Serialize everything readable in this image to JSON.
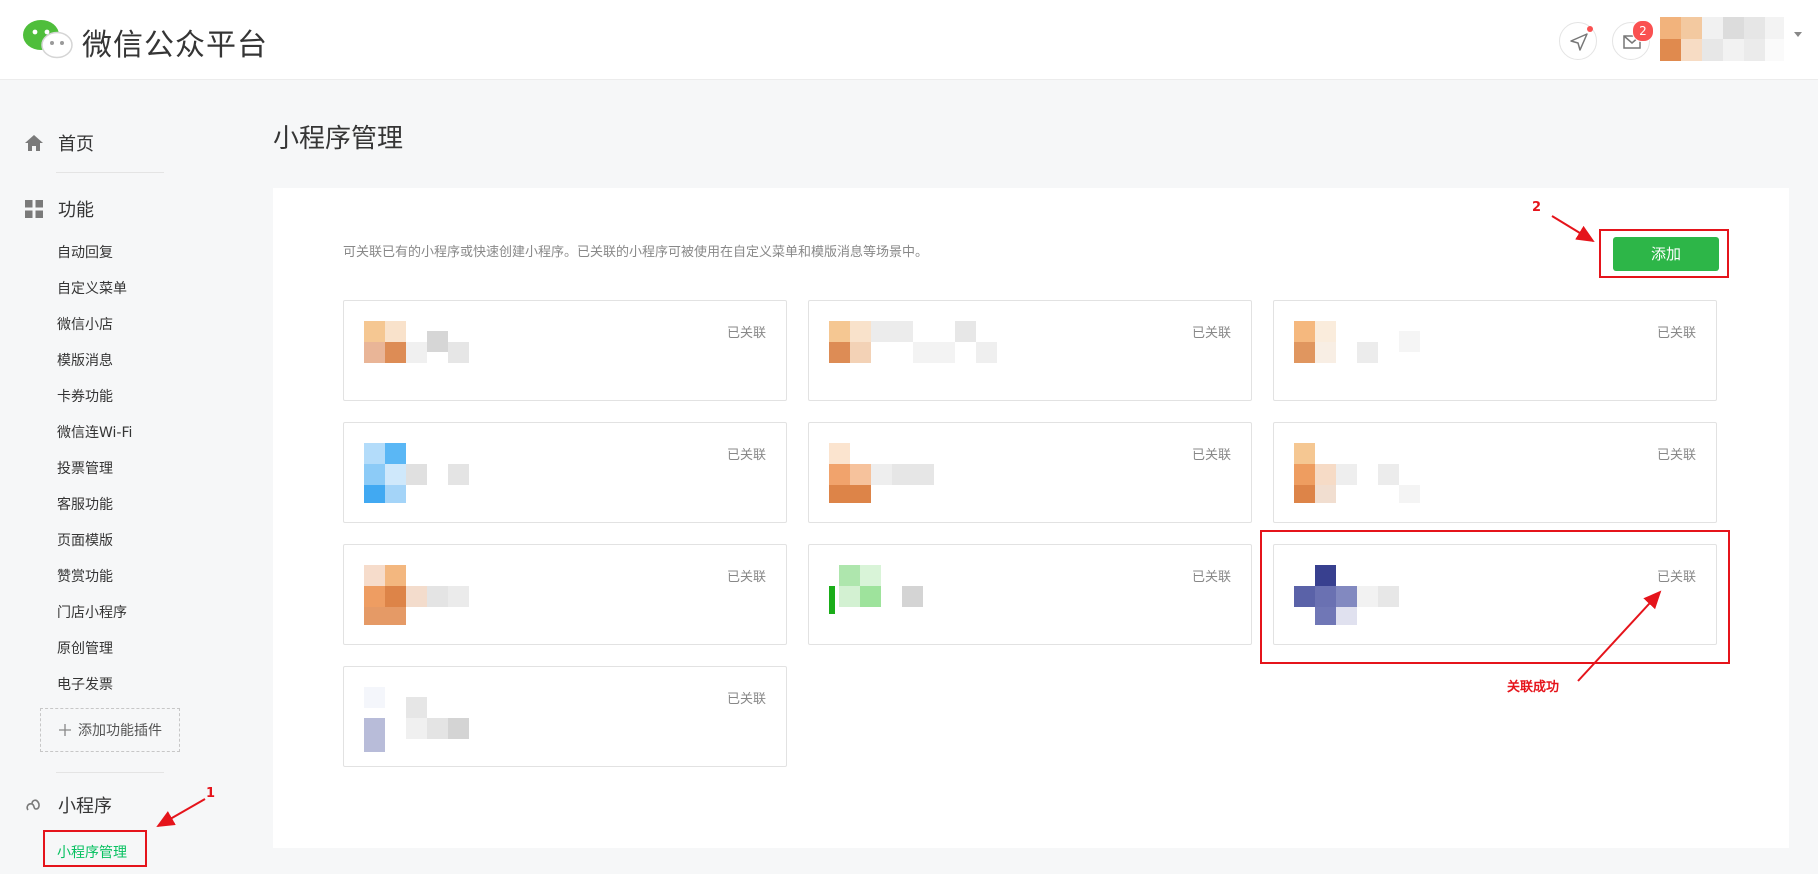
{
  "header": {
    "brand": "微信公众平台",
    "notification_count": "2",
    "icons": [
      "wechat-logo-icon",
      "send-icon",
      "mail-icon"
    ],
    "badge_color": "#fa5151"
  },
  "sidebar": {
    "home": "首页",
    "features": "功能",
    "feature_items": [
      "自动回复",
      "自定义菜单",
      "微信小店",
      "模版消息",
      "卡券功能",
      "微信连Wi-Fi",
      "投票管理",
      "客服功能",
      "页面模版",
      "赞赏功能",
      "门店小程序",
      "原创管理",
      "电子发票"
    ],
    "add_plugin": "添加功能插件",
    "mini_program": "小程序",
    "mini_program_manage": "小程序管理",
    "active_color": "#07c160"
  },
  "main": {
    "title": "小程序管理",
    "intro": "可关联已有的小程序或快速创建小程序。已关联的小程序可被使用在自定义菜单和模版消息等场景中。",
    "add_button": "添加",
    "add_button_color": "#2db648",
    "cards": [
      {
        "status": "已关联"
      },
      {
        "status": "已关联"
      },
      {
        "status": "已关联"
      },
      {
        "status": "已关联"
      },
      {
        "status": "已关联"
      },
      {
        "status": "已关联"
      },
      {
        "status": "已关联"
      },
      {
        "status": "已关联"
      },
      {
        "status": "已关联"
      },
      {
        "status": "已关联"
      }
    ]
  },
  "annotations": {
    "step1": "1",
    "step2": "2",
    "success": "关联成功",
    "color": "#e5141b"
  }
}
